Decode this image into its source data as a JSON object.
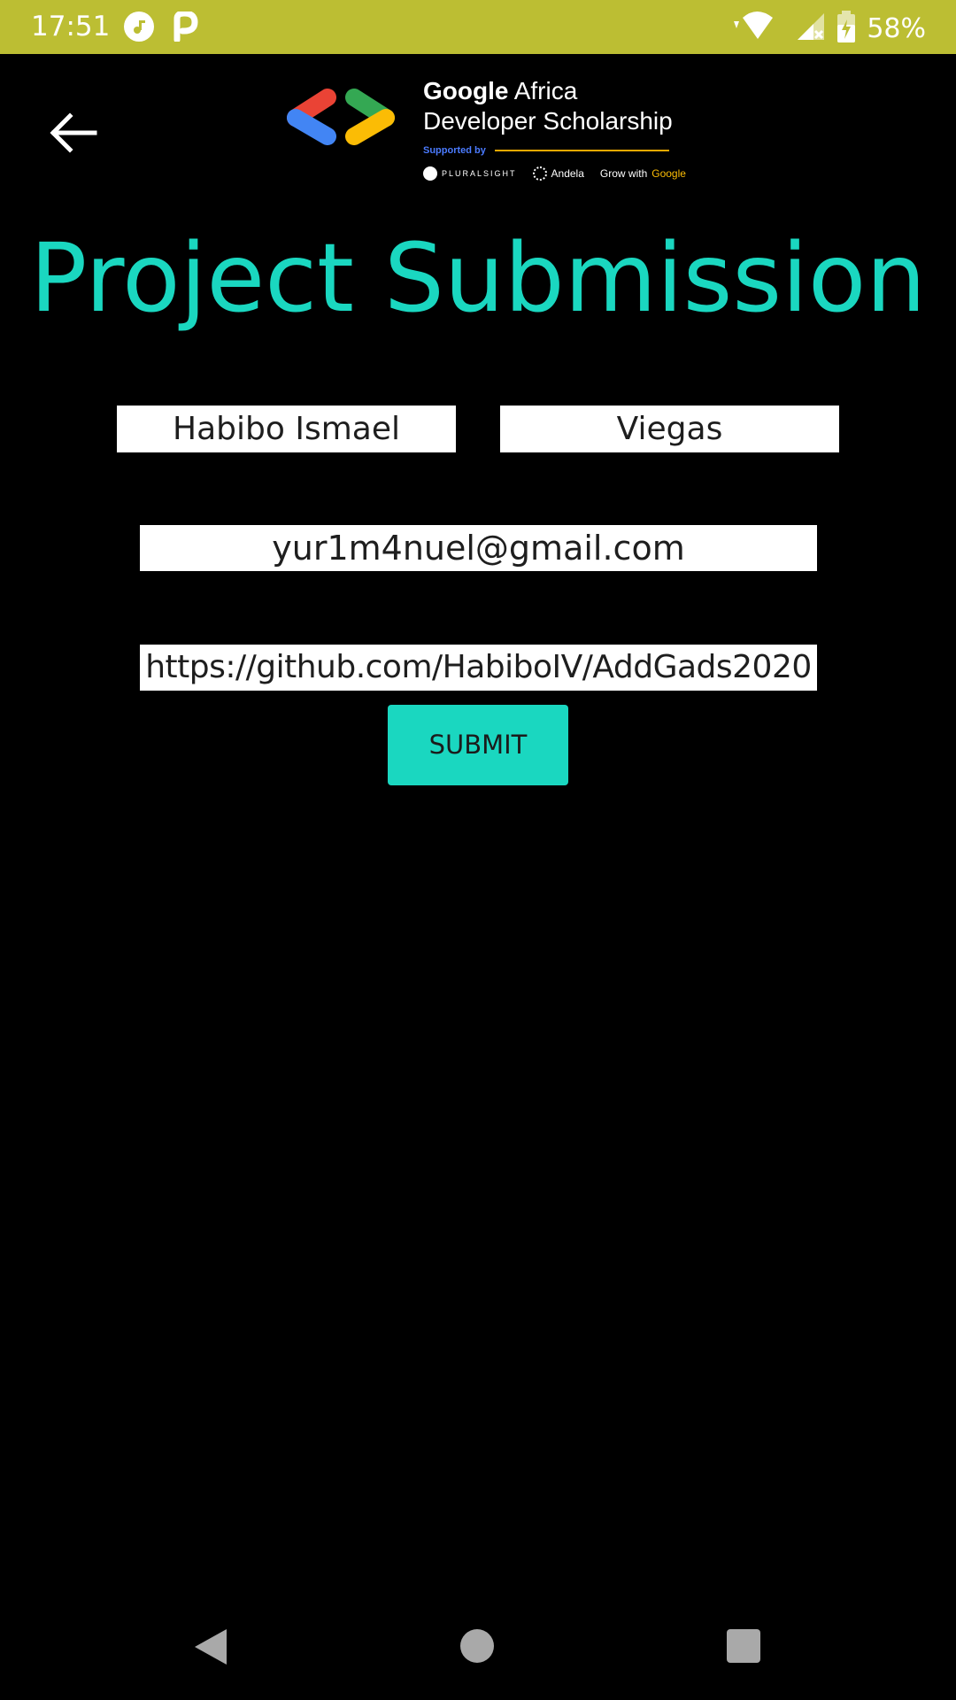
{
  "status_bar": {
    "time": "17:51",
    "battery_percent": "58%",
    "icons": [
      "music-note-icon",
      "p-icon",
      "wifi-icon",
      "signal-icon",
      "battery-charging-icon"
    ],
    "background": "#bcbe33"
  },
  "header": {
    "logo": {
      "line1_brand": "Google",
      "line1_rest": "Africa",
      "line2": "Developer Scholarship",
      "supported_by": "Supported by",
      "partners": [
        "PLURALSIGHT",
        "Andela",
        "Grow with",
        "Google"
      ]
    }
  },
  "page": {
    "title": "Project Submission",
    "accent_color": "#1ad7c0"
  },
  "form": {
    "first_name": "Habibo Ismael",
    "last_name": "Viegas",
    "email": "yur1m4nuel@gmail.com",
    "github_link": "https://github.com/HabiboIV/AddGads2020",
    "submit_label": "SUBMIT"
  },
  "nav_bar": {
    "icons": [
      "nav-back-icon",
      "nav-home-icon",
      "nav-recents-icon"
    ]
  }
}
